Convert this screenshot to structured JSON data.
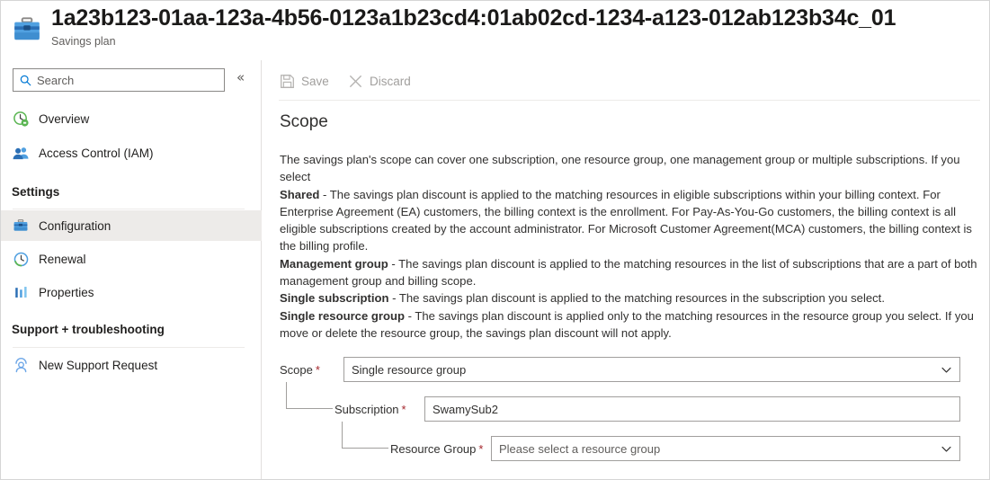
{
  "header": {
    "icon": "briefcase-icon",
    "title": "1a23b123-01aa-123a-4b56-0123a1b23cd4:01ab02cd-1234-a123-012ab123b34c_01",
    "subtitle": "Savings plan"
  },
  "sidebar": {
    "search": {
      "placeholder": "Search",
      "value": "",
      "icon": "search-icon"
    },
    "collapse": {
      "label": "«",
      "icon": "chevron-double-left-icon"
    },
    "items": [
      {
        "label": "Overview",
        "icon": "overview-icon",
        "selected": false
      },
      {
        "label": "Access Control (IAM)",
        "icon": "people-icon",
        "selected": false
      }
    ],
    "groups": [
      {
        "label": "Settings",
        "items": [
          {
            "label": "Configuration",
            "icon": "briefcase-icon",
            "selected": true
          },
          {
            "label": "Renewal",
            "icon": "clock-refresh-icon",
            "selected": false
          },
          {
            "label": "Properties",
            "icon": "bar-chart-icon",
            "selected": false
          }
        ]
      },
      {
        "label": "Support + troubleshooting",
        "items": [
          {
            "label": "New Support Request",
            "icon": "support-person-icon",
            "selected": false
          }
        ]
      }
    ]
  },
  "toolbar": {
    "save_label": "Save",
    "save_icon": "save-disk-icon",
    "discard_label": "Discard",
    "discard_icon": "close-x-icon",
    "disabled": true
  },
  "main": {
    "section_title": "Scope",
    "description": {
      "intro": "The savings plan's scope can cover one subscription, one resource group, one management group or multiple subscriptions. If you select",
      "items": [
        {
          "term": "Shared",
          "text": " - The savings plan discount is applied to the matching resources in eligible subscriptions within your billing context. For Enterprise Agreement (EA) customers, the billing context is the enrollment. For Pay-As-You-Go customers, the billing context is all eligible subscriptions created by the account administrator. For Microsoft Customer Agreement(MCA) customers, the billing context is the billing profile."
        },
        {
          "term": "Management group",
          "text": " - The savings plan discount is applied to the matching resources in the list of subscriptions that are a part of both management group and billing scope."
        },
        {
          "term": "Single subscription",
          "text": " - The savings plan discount is applied to the matching resources in the subscription you select."
        },
        {
          "term": "Single resource group",
          "text": " - The savings plan discount is applied only to the matching resources in the resource group you select. If you move or delete the resource group, the savings plan discount will not apply."
        }
      ]
    },
    "form": {
      "scope": {
        "label": "Scope",
        "required": true,
        "value": "Single resource group",
        "is_placeholder": false,
        "has_chevron": true
      },
      "subscription": {
        "label": "Subscription",
        "required": true,
        "value": "SwamySub2",
        "is_placeholder": false,
        "has_chevron": false
      },
      "resource_group": {
        "label": "Resource Group",
        "required": true,
        "value": "Please select a resource group",
        "is_placeholder": true,
        "has_chevron": true
      }
    }
  },
  "colors": {
    "accent": "#0078d4",
    "required_asterisk": "#a4262c",
    "selected_nav_bg": "#edebe9",
    "disabled_text": "#a19f9d"
  }
}
